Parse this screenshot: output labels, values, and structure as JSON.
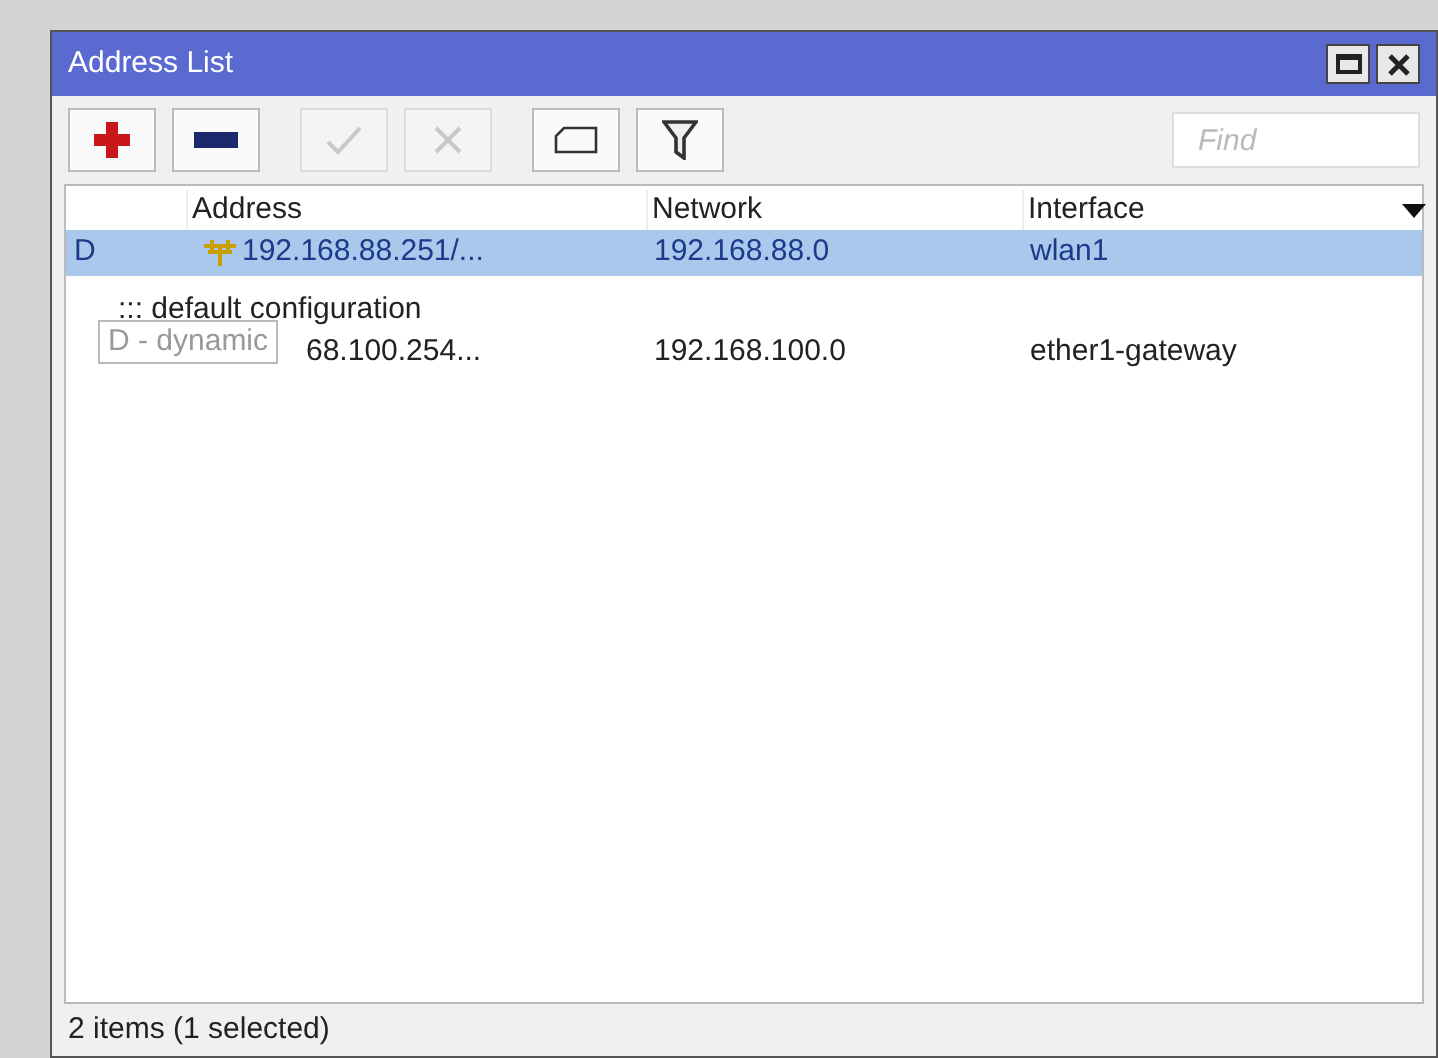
{
  "window": {
    "title": "Address List"
  },
  "toolbar": [
    {
      "kind": "add",
      "disabled": false
    },
    {
      "kind": "remove",
      "disabled": false
    },
    {
      "kind": "enable",
      "disabled": true
    },
    {
      "kind": "disable",
      "disabled": true
    },
    {
      "kind": "comment",
      "disabled": false
    },
    {
      "kind": "filter",
      "disabled": false
    }
  ],
  "search": {
    "placeholder": "Find"
  },
  "table": {
    "columns": [
      "Address",
      "Network",
      "Interface"
    ],
    "rows": [
      {
        "flag": "D",
        "address": "192.168.88.251/...",
        "network": "192.168.88.0",
        "interface": "wlan1",
        "selected": true
      },
      {
        "comment": "::: default configuration",
        "address": "68.100.254...",
        "network": "192.168.100.0",
        "interface": "ether1-gateway",
        "selected": false
      }
    ]
  },
  "tooltip": "D - dynamic",
  "status_bar": "2 items (1 selected)"
}
